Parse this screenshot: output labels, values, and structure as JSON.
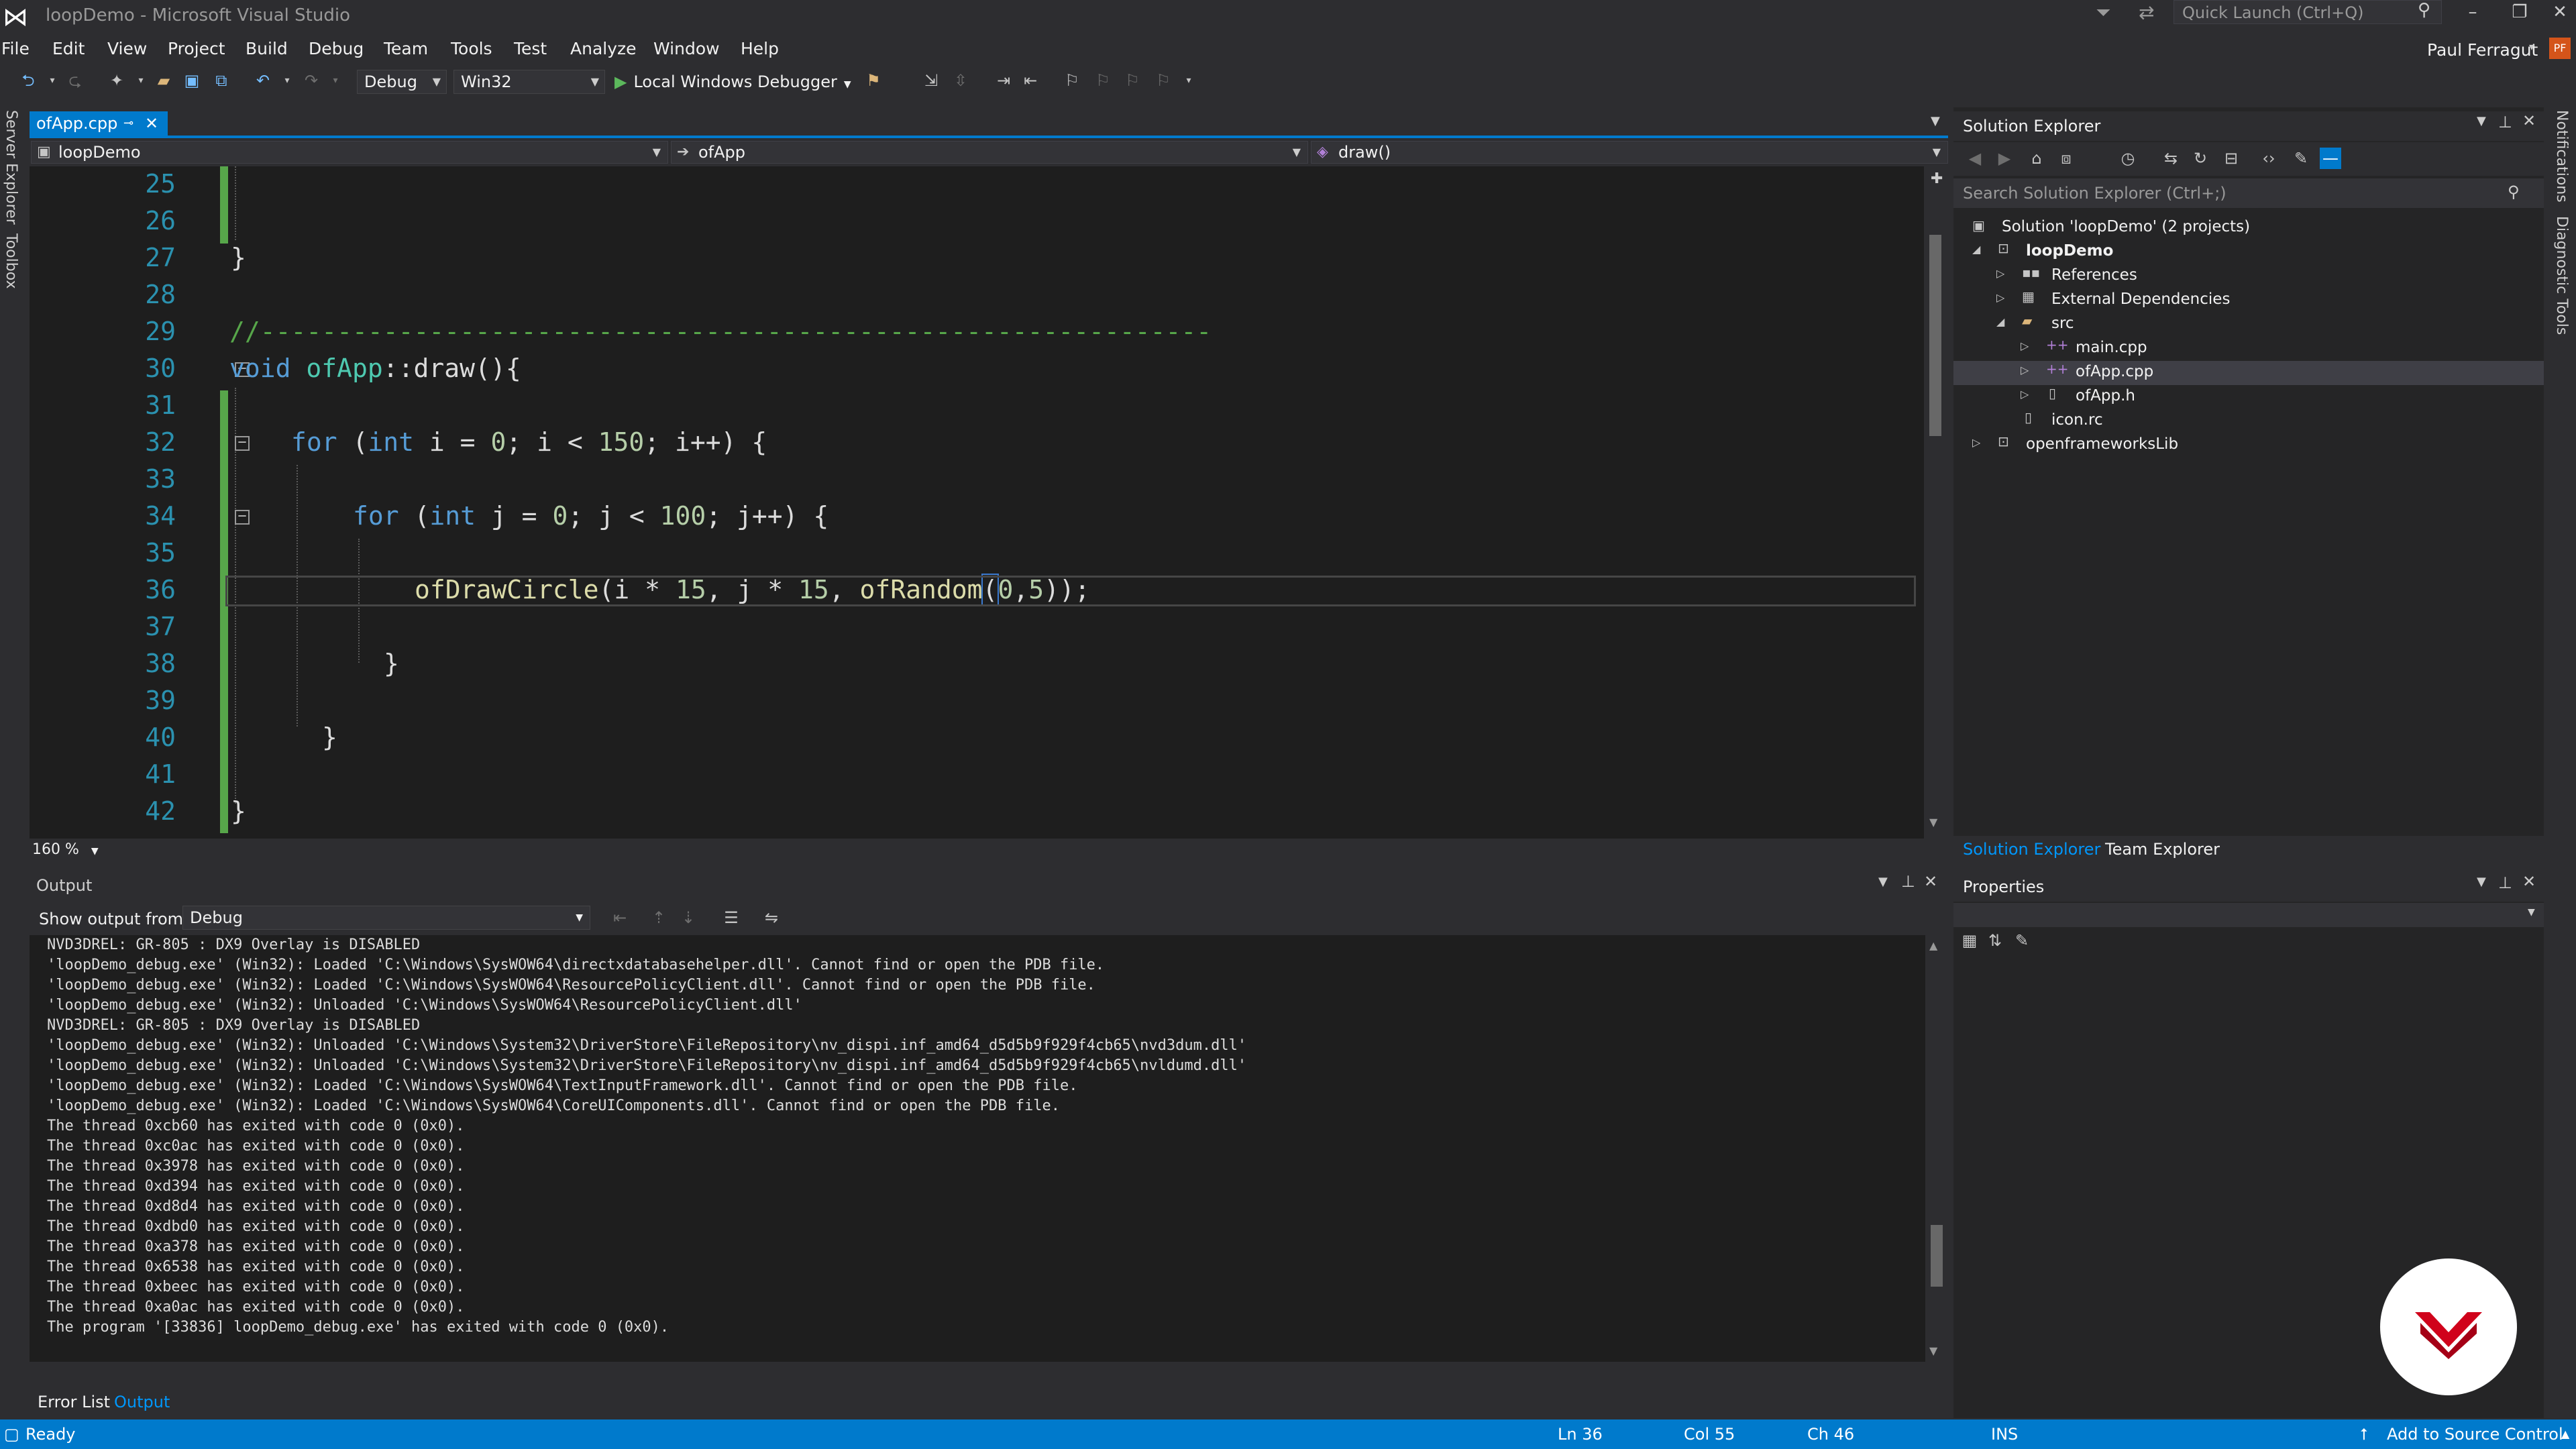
{
  "window": {
    "title": "loopDemo - Microsoft Visual Studio",
    "quick_launch_placeholder": "Quick Launch (Ctrl+Q)",
    "user_name": "Paul Ferragut",
    "user_initials": "PF"
  },
  "menu": [
    "File",
    "Edit",
    "View",
    "Project",
    "Build",
    "Debug",
    "Team",
    "Tools",
    "Test",
    "Analyze",
    "Window",
    "Help"
  ],
  "toolbar": {
    "config": "Debug",
    "platform": "Win32",
    "debugger": "Local Windows Debugger"
  },
  "left_strip": [
    "Server Explorer",
    "Toolbox"
  ],
  "right_strip": [
    "Notifications",
    "Diagnostic Tools"
  ],
  "editor": {
    "tab_name": "ofApp.cpp",
    "nav_project": "loopDemo",
    "nav_class": "ofApp",
    "nav_member": "draw()",
    "zoom": "160 %",
    "line_numbers": [
      "25",
      "26",
      "27",
      "28",
      "29",
      "30",
      "31",
      "32",
      "33",
      "34",
      "35",
      "36",
      "37",
      "38",
      "39",
      "40",
      "41",
      "42"
    ],
    "code": {
      "l27": "}",
      "l29": "//--------------------------------------------------------------",
      "l30_kw": "void",
      "l30_cls": "ofApp",
      "l30_rest": "::draw(){",
      "l32_kw": "for",
      "l32_a": " (",
      "l32_int": "int",
      "l32_b": " i = ",
      "l32_n1": "0",
      "l32_c": "; i < ",
      "l32_n2": "150",
      "l32_d": "; i++) {",
      "l34_kw": "for",
      "l34_a": " (",
      "l34_int": "int",
      "l34_b": " j = ",
      "l34_n1": "0",
      "l34_c": "; j < ",
      "l34_n2": "100",
      "l34_d": "; j++) {",
      "l36_fn": "ofDrawCircle",
      "l36_a": "(i * ",
      "l36_n1": "15",
      "l36_b": ", j * ",
      "l36_n2": "15",
      "l36_c": ", ",
      "l36_fn2": "ofRandom",
      "l36_d": "(",
      "l36_n3": "0",
      "l36_e": ",",
      "l36_n4": "5",
      "l36_f": "));",
      "l38": "}",
      "l40": "}",
      "l42": "}"
    }
  },
  "output": {
    "title": "Output",
    "show_from_label": "Show output from:",
    "source": "Debug",
    "lines": [
      "NVD3DREL: GR-805 : DX9 Overlay is DISABLED",
      "'loopDemo_debug.exe' (Win32): Loaded 'C:\\Windows\\SysWOW64\\directxdatabasehelper.dll'. Cannot find or open the PDB file.",
      "'loopDemo_debug.exe' (Win32): Loaded 'C:\\Windows\\SysWOW64\\ResourcePolicyClient.dll'. Cannot find or open the PDB file.",
      "'loopDemo_debug.exe' (Win32): Unloaded 'C:\\Windows\\SysWOW64\\ResourcePolicyClient.dll'",
      "NVD3DREL: GR-805 : DX9 Overlay is DISABLED",
      "'loopDemo_debug.exe' (Win32): Unloaded 'C:\\Windows\\System32\\DriverStore\\FileRepository\\nv_dispi.inf_amd64_d5d5b9f929f4cb65\\nvd3dum.dll'",
      "'loopDemo_debug.exe' (Win32): Unloaded 'C:\\Windows\\System32\\DriverStore\\FileRepository\\nv_dispi.inf_amd64_d5d5b9f929f4cb65\\nvldumd.dll'",
      "'loopDemo_debug.exe' (Win32): Loaded 'C:\\Windows\\SysWOW64\\TextInputFramework.dll'. Cannot find or open the PDB file.",
      "'loopDemo_debug.exe' (Win32): Loaded 'C:\\Windows\\SysWOW64\\CoreUIComponents.dll'. Cannot find or open the PDB file.",
      "The thread 0xcb60 has exited with code 0 (0x0).",
      "The thread 0xc0ac has exited with code 0 (0x0).",
      "The thread 0x3978 has exited with code 0 (0x0).",
      "The thread 0xd394 has exited with code 0 (0x0).",
      "The thread 0xd8d4 has exited with code 0 (0x0).",
      "The thread 0xdbd0 has exited with code 0 (0x0).",
      "The thread 0xa378 has exited with code 0 (0x0).",
      "The thread 0x6538 has exited with code 0 (0x0).",
      "The thread 0xbeec has exited with code 0 (0x0).",
      "The thread 0xa0ac has exited with code 0 (0x0).",
      "The program '[33836] loopDemo_debug.exe' has exited with code 0 (0x0)."
    ],
    "bottom_tabs": [
      "Error List",
      "Output"
    ]
  },
  "solution_explorer": {
    "title": "Solution Explorer",
    "search_placeholder": "Search Solution Explorer (Ctrl+;)",
    "items": [
      {
        "label": "Solution 'loopDemo' (2 projects)",
        "icon": "solution-icon"
      },
      {
        "label": "loopDemo",
        "icon": "project-icon"
      },
      {
        "label": "References",
        "icon": "references-icon"
      },
      {
        "label": "External Dependencies",
        "icon": "dependencies-icon"
      },
      {
        "label": "src",
        "icon": "folder-icon"
      },
      {
        "label": "main.cpp",
        "icon": "cpp-file-icon"
      },
      {
        "label": "ofApp.cpp",
        "icon": "cpp-file-icon"
      },
      {
        "label": "ofApp.h",
        "icon": "header-file-icon"
      },
      {
        "label": "icon.rc",
        "icon": "resource-file-icon"
      },
      {
        "label": "openframeworksLib",
        "icon": "project-icon"
      }
    ],
    "tabs": [
      "Solution Explorer",
      "Team Explorer"
    ]
  },
  "properties": {
    "title": "Properties"
  },
  "status": {
    "ready": "Ready",
    "ln": "Ln 36",
    "col": "Col 55",
    "ch": "Ch 46",
    "mode": "INS",
    "source_control": "Add to Source Control"
  },
  "colors": {
    "accent": "#007acc",
    "editor_bg": "#1e1e1e",
    "keyword": "#569cd6",
    "number": "#b5cea8",
    "comment": "#57a64a",
    "line_number": "#2b91af",
    "badge": "#d0021b"
  }
}
